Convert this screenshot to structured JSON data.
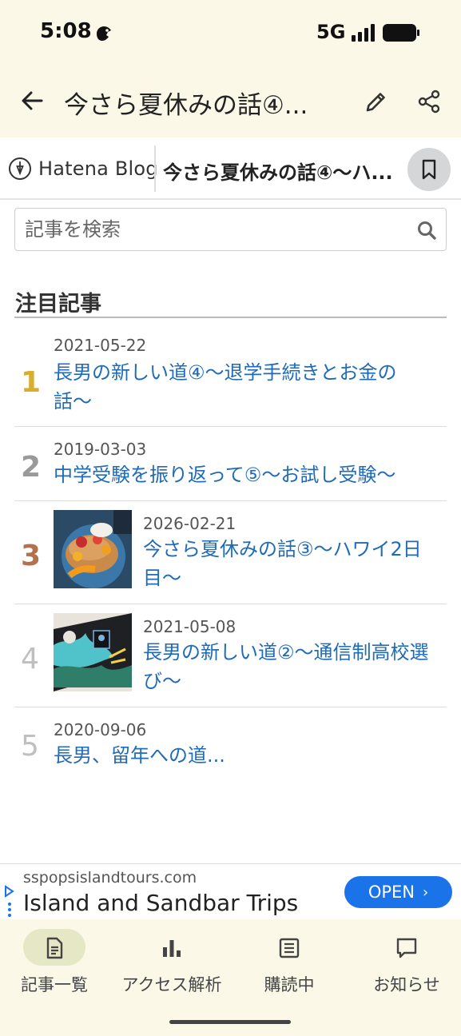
{
  "status_bar": {
    "time": "5:08",
    "network": "5G"
  },
  "app_bar": {
    "title": "今さら夏休みの話④..."
  },
  "blog_header": {
    "logo_text": "Hatena Blog",
    "title": "今さら夏休みの話④〜ハ..."
  },
  "search": {
    "placeholder": "記事を検索",
    "value": ""
  },
  "featured": {
    "heading": "注目記事",
    "entries": [
      {
        "rank": "1",
        "date": "2021-05-22",
        "title_lines": [
          "長男の新しい道④〜退学手続きとお金の",
          "話〜"
        ],
        "rank_color": "#d9ad2e",
        "has_thumbnail": false
      },
      {
        "rank": "2",
        "date": "2019-03-03",
        "title_lines": [
          "中学受験を振り返って⑤〜お試し受験〜"
        ],
        "rank_color": "#9a9a9a",
        "has_thumbnail": false
      },
      {
        "rank": "3",
        "date": "2026-02-21",
        "title_lines": [
          "今さら夏休みの話③〜ハワイ2日",
          "目〜"
        ],
        "rank_color": "#b5714c",
        "has_thumbnail": true,
        "thumbnail": "pancake-photo"
      },
      {
        "rank": "4",
        "date": "2021-05-08",
        "title_lines": [
          "長男の新しい道②〜通信制高校選",
          "び〜"
        ],
        "rank_color": "#bfbfbf",
        "has_thumbnail": true,
        "thumbnail": "artwork-photo"
      },
      {
        "rank": "5",
        "date": "2020-09-06",
        "title_lines": [
          "長男、留年への道..."
        ],
        "rank_color": "#bfbfbf",
        "has_thumbnail": false
      }
    ]
  },
  "ad": {
    "domain": "sspopsislandtours.com",
    "headline": "Island and Sandbar Trips",
    "cta": "OPEN"
  },
  "bottom_nav": {
    "items": [
      {
        "label": "記事一覧",
        "icon": "document-icon",
        "active": true
      },
      {
        "label": "アクセス解析",
        "icon": "bar-chart-icon",
        "active": false
      },
      {
        "label": "購読中",
        "icon": "newspaper-icon",
        "active": false
      },
      {
        "label": "お知らせ",
        "icon": "message-icon",
        "active": false
      }
    ]
  },
  "colors": {
    "accent_link": "#1f6bb8",
    "header_bg": "#fbf8e7",
    "cta_blue": "#1a73e8"
  }
}
